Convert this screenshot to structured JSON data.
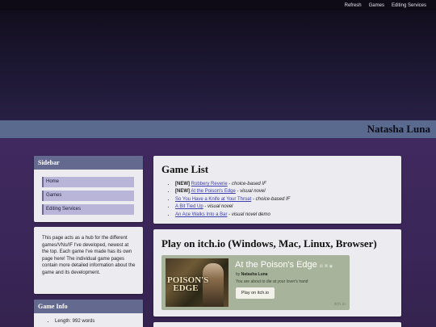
{
  "topnav": {
    "links": [
      "Refresh",
      "Games",
      "Editing Services"
    ]
  },
  "site_title": "Natasha Luna",
  "sidebar": {
    "heading": "Sidebar",
    "nav": [
      "Home",
      "Games",
      "Editing Services"
    ]
  },
  "about_text": "This page acts as a hub for the different games/VNs/IF I've developed, newest at the top. Each game I've made has its own page here! The individual game pages contain more detailed information about the game and its development.",
  "game_info": {
    "heading": "Game Info",
    "items": [
      "Length: 992 words"
    ]
  },
  "game_list": {
    "heading": "Game List",
    "items": [
      {
        "prefix": "[NEW]",
        "title": "Robbery Reverie",
        "desc": "choice-based IF"
      },
      {
        "prefix": "[NEW]",
        "title": "At the Poison's Edge",
        "desc": "visual novel"
      },
      {
        "prefix": "",
        "title": "So You Have a Knife at Your Throat",
        "desc": "choice-based IF"
      },
      {
        "prefix": "",
        "title": "A Bit Tied Up",
        "desc": "visual novel"
      },
      {
        "prefix": "",
        "title": "An Ace Walks Into a Bar",
        "desc": "visual novel demo"
      }
    ],
    "separator": " - "
  },
  "itch_section": {
    "heading": "Play on itch.io (Windows, Mac, Linux, Browser)",
    "widget": {
      "cover_logo": "POISON'S EDGE",
      "title": "At the Poison's Edge",
      "platform_tags": "⊞ ⌘ ◉",
      "by_prefix": "by",
      "author": "Natasha Luna",
      "description": "You are about to die at your lover's hand",
      "button": "Play on itch.io",
      "brand": "itch.io"
    }
  },
  "colors": {
    "panel_header": "#646990",
    "nav_button": "#b8b5d9",
    "link": "#3c3fb0",
    "title_bar": "#5a6a8e"
  }
}
